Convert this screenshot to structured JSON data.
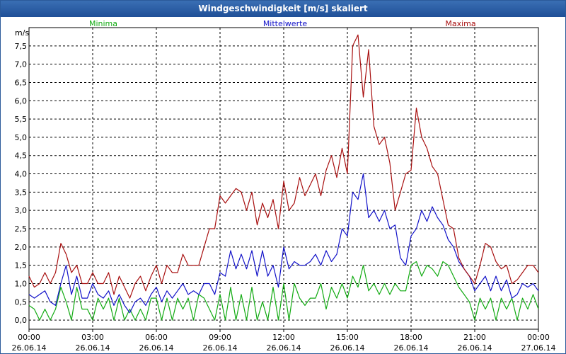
{
  "window": {
    "title": "Windgeschwindigkeit [m/s] skaliert"
  },
  "colors": {
    "minima": "#11aa11",
    "mittelwerte": "#1111c8",
    "maxima": "#a81010",
    "grid": "#000000"
  },
  "chart_data": {
    "type": "line",
    "title": "Windgeschwindigkeit [m/s] skaliert",
    "ylabel": "m/s",
    "xlabel": "",
    "ylim": [
      -0.25,
      8.0
    ],
    "y_ticks": [
      "0,0",
      "0,5",
      "1,0",
      "1,5",
      "2,0",
      "2,5",
      "3,0",
      "3,5",
      "4,0",
      "4,5",
      "5,0",
      "5,5",
      "6,0",
      "6,5",
      "7,0",
      "7,5"
    ],
    "x_ticks": [
      {
        "time": "00:00",
        "date": "26.06.14"
      },
      {
        "time": "03:00",
        "date": "26.06.14"
      },
      {
        "time": "06:00",
        "date": "26.06.14"
      },
      {
        "time": "09:00",
        "date": "26.06.14"
      },
      {
        "time": "12:00",
        "date": "26.06.14"
      },
      {
        "time": "15:00",
        "date": "26.06.14"
      },
      {
        "time": "18:00",
        "date": "26.06.14"
      },
      {
        "time": "21:00",
        "date": "26.06.14"
      },
      {
        "time": "00:00",
        "date": "27.06.14"
      }
    ],
    "x_range_hours": [
      0,
      24
    ],
    "grid": true,
    "legend_position": "top",
    "series": [
      {
        "name": "Minima",
        "x": [
          0,
          0.25,
          0.5,
          0.75,
          1,
          1.25,
          1.5,
          1.75,
          2,
          2.25,
          2.5,
          2.75,
          3,
          3.25,
          3.5,
          3.75,
          4,
          4.25,
          4.5,
          4.75,
          5,
          5.25,
          5.5,
          5.75,
          6,
          6.25,
          6.5,
          6.75,
          7,
          7.25,
          7.5,
          7.75,
          8,
          8.25,
          8.5,
          8.75,
          9,
          9.25,
          9.5,
          9.75,
          10,
          10.25,
          10.5,
          10.75,
          11,
          11.25,
          11.5,
          11.75,
          12,
          12.25,
          12.5,
          12.75,
          13,
          13.25,
          13.5,
          13.75,
          14,
          14.25,
          14.5,
          14.75,
          15,
          15.25,
          15.5,
          15.75,
          16,
          16.25,
          16.5,
          16.75,
          17,
          17.25,
          17.5,
          17.75,
          18,
          18.25,
          18.5,
          18.75,
          19,
          19.25,
          19.5,
          19.75,
          20,
          20.25,
          20.5,
          20.75,
          21,
          21.25,
          21.5,
          21.75,
          22,
          22.25,
          22.5,
          22.75,
          23,
          23.25,
          23.5,
          23.75,
          24
        ],
        "values": [
          0.4,
          0.3,
          0.0,
          0.3,
          0.0,
          0.3,
          0.9,
          0.5,
          0.0,
          0.9,
          0.3,
          0.3,
          0.0,
          0.6,
          0.3,
          0.6,
          0.0,
          0.6,
          0.0,
          0.3,
          0.0,
          0.3,
          0.0,
          0.6,
          0.6,
          0.0,
          0.6,
          0.0,
          0.6,
          0.3,
          0.6,
          0.0,
          0.7,
          0.6,
          0.3,
          0.0,
          0.7,
          0.0,
          0.9,
          0.0,
          0.7,
          0.0,
          0.9,
          0.0,
          0.5,
          0.0,
          0.9,
          0.0,
          1.0,
          0.0,
          1.0,
          0.6,
          0.4,
          0.6,
          0.6,
          1.0,
          0.3,
          0.9,
          0.6,
          1.0,
          0.6,
          1.2,
          0.9,
          1.5,
          0.8,
          1.0,
          0.7,
          1.0,
          0.7,
          1.0,
          0.8,
          0.8,
          1.5,
          1.6,
          1.2,
          1.5,
          1.4,
          1.2,
          1.6,
          1.5,
          1.2,
          0.9,
          0.7,
          0.5,
          0.0,
          0.6,
          0.3,
          0.6,
          0.0,
          0.6,
          0.3,
          0.6,
          0.0,
          0.6,
          0.3,
          0.7,
          0.3
        ]
      },
      {
        "name": "Mittelwerte",
        "x": [
          0,
          0.25,
          0.5,
          0.75,
          1,
          1.25,
          1.5,
          1.75,
          2,
          2.25,
          2.5,
          2.75,
          3,
          3.25,
          3.5,
          3.75,
          4,
          4.25,
          4.5,
          4.75,
          5,
          5.25,
          5.5,
          5.75,
          6,
          6.25,
          6.5,
          6.75,
          7,
          7.25,
          7.5,
          7.75,
          8,
          8.25,
          8.5,
          8.75,
          9,
          9.25,
          9.5,
          9.75,
          10,
          10.25,
          10.5,
          10.75,
          11,
          11.25,
          11.5,
          11.75,
          12,
          12.25,
          12.5,
          12.75,
          13,
          13.25,
          13.5,
          13.75,
          14,
          14.25,
          14.5,
          14.75,
          15,
          15.25,
          15.5,
          15.75,
          16,
          16.25,
          16.5,
          16.75,
          17,
          17.25,
          17.5,
          17.75,
          18,
          18.25,
          18.5,
          18.75,
          19,
          19.25,
          19.5,
          19.75,
          20,
          20.25,
          20.5,
          20.75,
          21,
          21.25,
          21.5,
          21.75,
          22,
          22.25,
          22.5,
          22.75,
          23,
          23.25,
          23.5,
          23.75,
          24
        ],
        "values": [
          0.7,
          0.6,
          0.7,
          0.8,
          0.5,
          0.4,
          1.0,
          1.5,
          0.7,
          1.2,
          0.6,
          0.6,
          1.0,
          0.7,
          0.6,
          0.8,
          0.4,
          0.7,
          0.4,
          0.2,
          0.5,
          0.6,
          0.4,
          0.7,
          0.9,
          0.5,
          0.8,
          0.6,
          0.8,
          1.0,
          0.7,
          0.8,
          0.7,
          1.0,
          1.0,
          0.7,
          1.3,
          1.2,
          1.9,
          1.4,
          1.8,
          1.4,
          1.9,
          1.2,
          1.9,
          1.2,
          1.5,
          0.9,
          2.0,
          1.4,
          1.6,
          1.5,
          1.5,
          1.6,
          1.8,
          1.5,
          1.9,
          1.6,
          1.8,
          2.5,
          2.3,
          3.5,
          3.3,
          4.0,
          2.8,
          3.0,
          2.7,
          3.0,
          2.5,
          2.6,
          1.7,
          1.5,
          2.3,
          2.5,
          3.0,
          2.7,
          3.1,
          2.8,
          2.6,
          2.2,
          2.0,
          1.6,
          1.4,
          1.2,
          0.8,
          1.0,
          1.2,
          0.8,
          1.2,
          0.8,
          1.1,
          0.6,
          0.7,
          1.0,
          0.9,
          1.0,
          0.8
        ]
      },
      {
        "name": "Maxima",
        "x": [
          0,
          0.25,
          0.5,
          0.75,
          1,
          1.25,
          1.5,
          1.75,
          2,
          2.25,
          2.5,
          2.75,
          3,
          3.25,
          3.5,
          3.75,
          4,
          4.25,
          4.5,
          4.75,
          5,
          5.25,
          5.5,
          5.75,
          6,
          6.25,
          6.5,
          6.75,
          7,
          7.25,
          7.5,
          7.75,
          8,
          8.25,
          8.5,
          8.75,
          9,
          9.25,
          9.5,
          9.75,
          10,
          10.25,
          10.5,
          10.75,
          11,
          11.25,
          11.5,
          11.75,
          12,
          12.25,
          12.5,
          12.75,
          13,
          13.25,
          13.5,
          13.75,
          14,
          14.25,
          14.5,
          14.75,
          15,
          15.25,
          15.5,
          15.75,
          16,
          16.25,
          16.5,
          16.75,
          17,
          17.25,
          17.5,
          17.75,
          18,
          18.25,
          18.5,
          18.75,
          19,
          19.25,
          19.5,
          19.75,
          20,
          20.25,
          20.5,
          20.75,
          21,
          21.25,
          21.5,
          21.75,
          22,
          22.25,
          22.5,
          22.75,
          23,
          23.25,
          23.5,
          23.75,
          24
        ],
        "values": [
          1.2,
          0.9,
          1.0,
          1.3,
          1.0,
          1.3,
          2.1,
          1.8,
          1.3,
          1.5,
          1.0,
          1.0,
          1.3,
          1.0,
          1.0,
          1.3,
          0.7,
          1.2,
          0.9,
          0.6,
          1.0,
          1.2,
          0.8,
          1.2,
          1.5,
          1.0,
          1.5,
          1.3,
          1.3,
          1.8,
          1.5,
          1.5,
          1.5,
          2.0,
          2.5,
          2.5,
          3.4,
          3.2,
          3.4,
          3.6,
          3.5,
          3.0,
          3.5,
          2.6,
          3.2,
          2.8,
          3.3,
          2.5,
          3.8,
          3.0,
          3.2,
          3.9,
          3.4,
          3.7,
          4.0,
          3.4,
          4.1,
          4.5,
          3.9,
          4.7,
          4.0,
          7.5,
          7.8,
          6.1,
          7.4,
          5.3,
          4.8,
          5.0,
          4.3,
          3.0,
          3.5,
          4.0,
          4.1,
          5.8,
          5.0,
          4.7,
          4.2,
          4.0,
          3.3,
          2.6,
          2.5,
          1.7,
          1.4,
          1.2,
          1.0,
          1.5,
          2.1,
          2.0,
          1.6,
          1.4,
          1.5,
          1.0,
          1.1,
          1.3,
          1.5,
          1.5,
          1.3
        ]
      }
    ]
  }
}
